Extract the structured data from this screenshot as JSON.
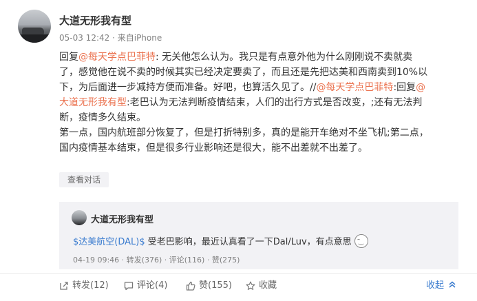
{
  "post": {
    "username": "大道无形我有型",
    "timestamp": "05-03 12:42",
    "source": "来自iPhone",
    "lines": [
      [
        {
          "text": "回复"
        },
        {
          "text": "@每天学点巴菲特",
          "link": true
        },
        {
          "text": ": 无关他怎么认为。我只是有点意外他为什么刚刚说不卖就卖"
        }
      ],
      [
        {
          "text": "了，感觉他在说不卖的时候其实已经决定要卖了，而且还是先把达美和西南卖到10%以"
        }
      ],
      [
        {
          "text": "下，为后面进一步减持方便而准备。好吧，也算活久见了。//"
        },
        {
          "text": "@每天学点巴菲特",
          "link": true
        },
        {
          "text": ":回复"
        },
        {
          "text": "@",
          "link": true
        }
      ],
      [
        {
          "text": "大道无形我有型",
          "link": true
        },
        {
          "text": ":老巴认为无法判断疫情结束，人们的出行方式是否改变，;还有无法判"
        }
      ],
      [
        {
          "text": "断，疫情多久结束。"
        }
      ],
      [
        {
          "text": "第一点，国内航班部分恢复了，但是打折特别多，真的是能开车绝对不坐飞机;第二点，"
        }
      ],
      [
        {
          "text": "国内疫情基本结束，但是很多行业影响还是很大，能不出差就不出差了。"
        }
      ]
    ],
    "view_conversation": "查看对话"
  },
  "quoted": {
    "username": "大道无形我有型",
    "stock": "$达美航空(DAL)$",
    "text": " 受老巴影响，最近认真看了一下Dal/Luv，有点意思",
    "timestamp": "04-19 09:46",
    "repost": "转发(376)",
    "comment": "评论(116)",
    "like": "赞(275)"
  },
  "actions": {
    "repost": "转发(12)",
    "comment": "评论(4)",
    "like": "赞(155)",
    "favorite": "收藏",
    "collapse": "收起"
  }
}
